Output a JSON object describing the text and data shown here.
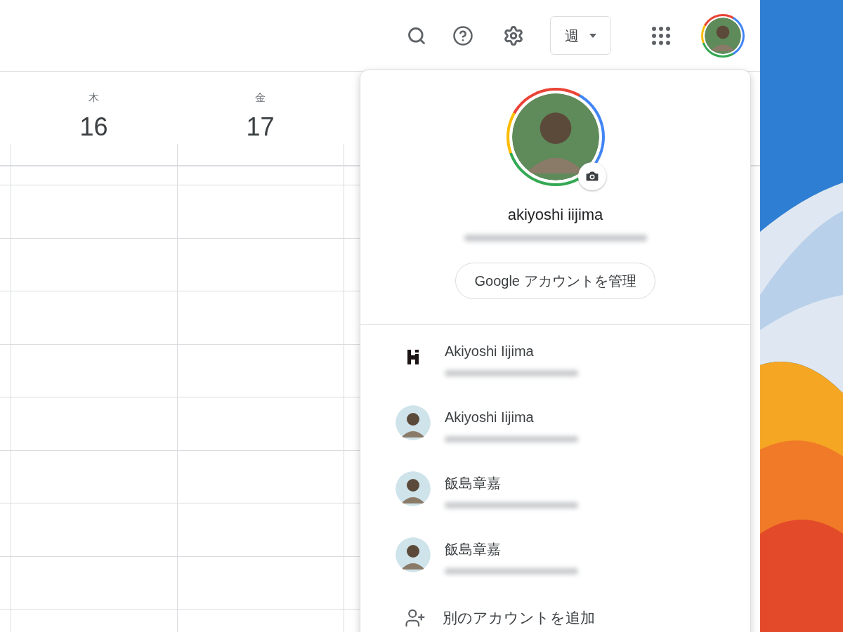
{
  "toolbar": {
    "view_select": "週"
  },
  "days": [
    {
      "weekday": "木",
      "date": "16"
    },
    {
      "weekday": "金",
      "date": "17"
    }
  ],
  "account_menu": {
    "name": "akiyoshi iijima",
    "manage_button": "Google アカウントを管理",
    "accounts": [
      {
        "name": "Akiyoshi Iijima",
        "kind": "logo"
      },
      {
        "name": "Akiyoshi Iijima"
      },
      {
        "name": "飯島章嘉"
      },
      {
        "name": "飯島章嘉"
      }
    ],
    "add_account": "別のアカウントを追加"
  }
}
